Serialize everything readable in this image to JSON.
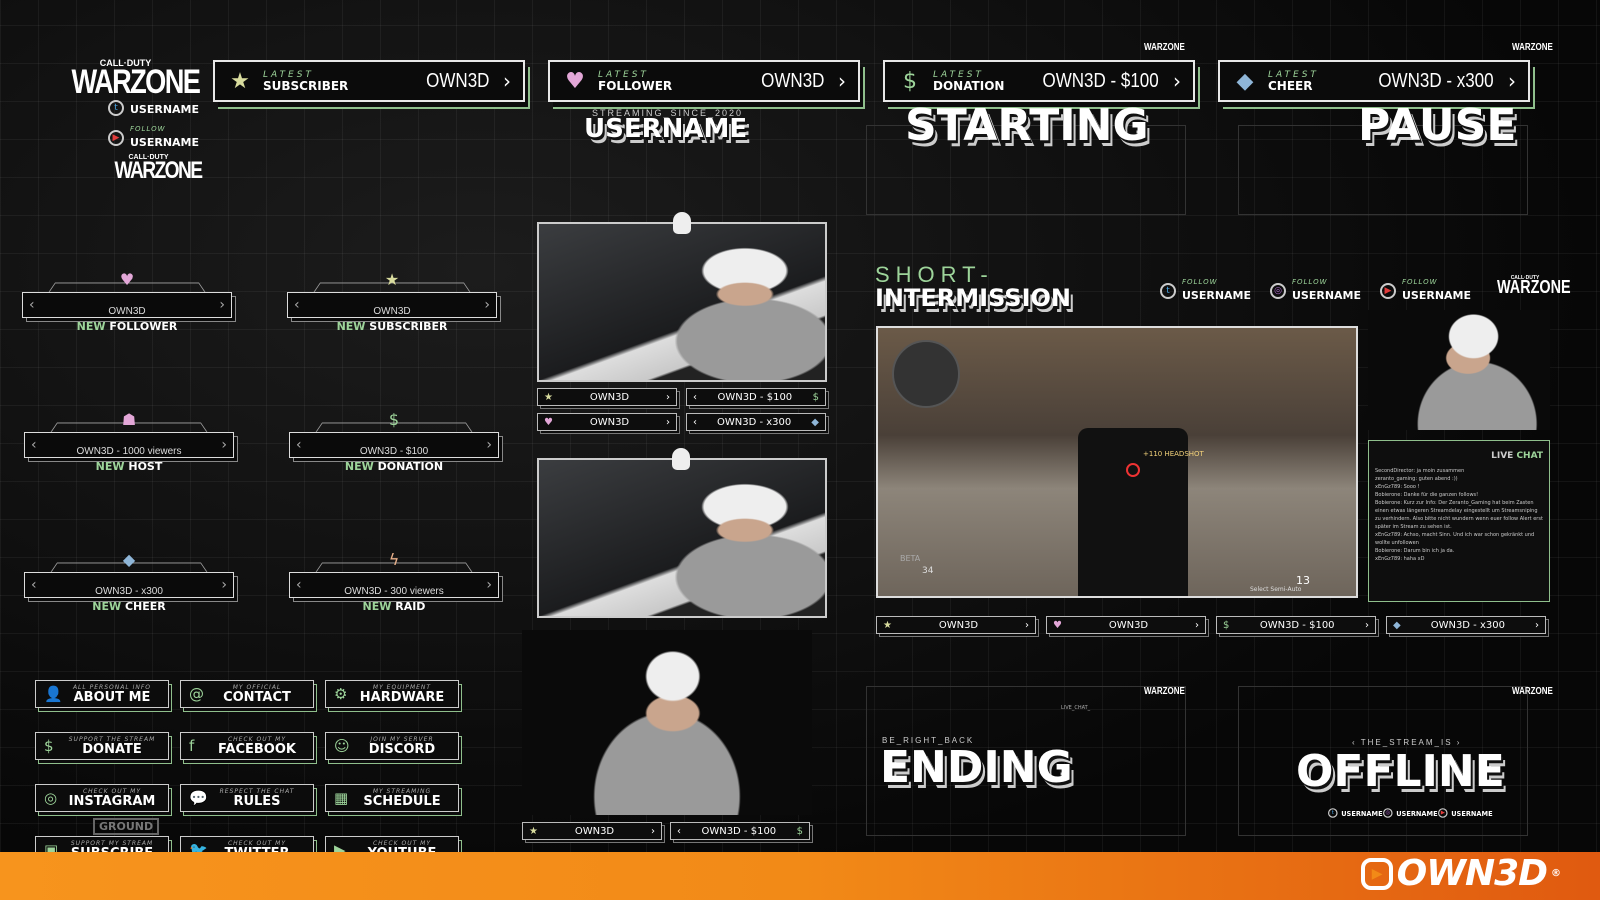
{
  "brand": {
    "game_logo_top": "CALL·DUTY",
    "game_logo_main": "WARZONE",
    "owned_logo": "OWN3D",
    "registered": "®"
  },
  "latest_bars": [
    {
      "label_small": "LATEST",
      "label": "SUBSCRIBER",
      "value": "OWN3D",
      "icon": "star-icon",
      "icon_glyph": "★",
      "color": "#d9dc9e"
    },
    {
      "label_small": "LATEST",
      "label": "FOLLOWER",
      "value": "OWN3D",
      "icon": "heart-icon",
      "icon_glyph": "♥",
      "color": "#e3a7d8"
    },
    {
      "label_small": "LATEST",
      "label": "DONATION",
      "value": "OWN3D - $100",
      "icon": "dollar-icon",
      "icon_glyph": "$",
      "color": "#9dd49a"
    },
    {
      "label_small": "LATEST",
      "label": "CHEER",
      "value": "OWN3D - x300",
      "icon": "diamond-icon",
      "icon_glyph": "◆",
      "color": "#8fb6d8"
    }
  ],
  "top_left": {
    "follow_1": {
      "label": "FOLLOW",
      "user": "USERNAME"
    },
    "follow_2": {
      "label": "FOLLOW",
      "user": "USERNAME"
    }
  },
  "streaming_since": "STREAMING_SINCE_2020",
  "username_title": "USERNAME",
  "scenes": {
    "starting": "STARTING",
    "pause": "PAUSE",
    "ending": "ENDING",
    "offline": "OFFLINE",
    "be_right_back": "BE_RIGHT_BACK",
    "the_stream_is": "‹ THE_STREAM_IS ›"
  },
  "intermission": {
    "line1": "SHORT-",
    "line2": "INTERMISSION",
    "follows": [
      {
        "label": "FOLLOW",
        "user": "USERNAME",
        "icon": "twitter-icon"
      },
      {
        "label": "FOLLOW",
        "user": "USERNAME",
        "icon": "instagram-icon"
      },
      {
        "label": "FOLLOW",
        "user": "USERNAME",
        "icon": "youtube-icon"
      }
    ]
  },
  "alerts": [
    {
      "prefix": "NEW",
      "type": "FOLLOWER",
      "value": "OWN3D",
      "icon": "heart-icon",
      "glyph": "♥",
      "color": "#e3a7d8"
    },
    {
      "prefix": "NEW",
      "type": "SUBSCRIBER",
      "value": "OWN3D",
      "icon": "star-icon",
      "glyph": "★",
      "color": "#d9dc9e"
    },
    {
      "prefix": "NEW",
      "type": "HOST",
      "value": "OWN3D - 1000 viewers",
      "icon": "group-icon",
      "glyph": "☗",
      "color": "#e3a7d8"
    },
    {
      "prefix": "NEW",
      "type": "DONATION",
      "value": "OWN3D - $100",
      "icon": "dollar-icon",
      "glyph": "$",
      "color": "#9dd49a"
    },
    {
      "prefix": "NEW",
      "type": "CHEER",
      "value": "OWN3D - x300",
      "icon": "diamond-icon",
      "glyph": "◆",
      "color": "#8fb6d8"
    },
    {
      "prefix": "NEW",
      "type": "RAID",
      "value": "OWN3D - 300 viewers",
      "icon": "lightning-icon",
      "glyph": "ϟ",
      "color": "#e8b08a"
    }
  ],
  "panels": [
    {
      "sub": "ALL PERSONAL INFO",
      "title": "ABOUT ME",
      "icon": "user-icon",
      "glyph": "👤"
    },
    {
      "sub": "MY OFFICIAL",
      "title": "CONTACT",
      "icon": "at-icon",
      "glyph": "@"
    },
    {
      "sub": "MY EQUIPMENT",
      "title": "HARDWARE",
      "icon": "gear-icon",
      "glyph": "⚙"
    },
    {
      "sub": "SUPPORT THE STREAM",
      "title": "DONATE",
      "icon": "dollar-icon",
      "glyph": "$"
    },
    {
      "sub": "CHECK OUT MY",
      "title": "FACEBOOK",
      "icon": "facebook-icon",
      "glyph": "f"
    },
    {
      "sub": "JOIN MY SERVER",
      "title": "DISCORD",
      "icon": "discord-icon",
      "glyph": "☺"
    },
    {
      "sub": "CHECK OUT MY",
      "title": "INSTAGRAM",
      "icon": "instagram-icon",
      "glyph": "◎"
    },
    {
      "sub": "RESPECT THE CHAT",
      "title": "RULES",
      "icon": "chat-icon",
      "glyph": "💬"
    },
    {
      "sub": "MY STREAMING",
      "title": "SCHEDULE",
      "icon": "calendar-icon",
      "glyph": "▦"
    },
    {
      "sub": "SUPPORT MY STREAM",
      "title": "SUBSCRIBE",
      "icon": "twitch-icon",
      "glyph": "▣"
    },
    {
      "sub": "CHECK OUT MY",
      "title": "TWITTER",
      "icon": "twitter-icon",
      "glyph": "🐦"
    },
    {
      "sub": "CHECK OUT MY",
      "title": "YOUTUBE",
      "icon": "youtube-icon",
      "glyph": "▶"
    }
  ],
  "ground_label": "GROUND",
  "cam_labels": {
    "sub": "OWN3D",
    "donation": "OWN3D - $100",
    "follower": "OWN3D",
    "cheer": "OWN3D - x300"
  },
  "chat": {
    "title_1": "LIVE",
    "title_2": "CHAT",
    "lines": [
      "SecondDirector: ja moin zusammen",
      "zeranto_gaming: guten abend :))",
      "xEnGz789: Sooo !",
      "Bobierone: Danke für die ganzen follows!",
      "Bobierone: Kurz zur Info: Der Zeranto_Gaming hat beim Zasten einen etwas längeren Streamdelay eingestellt um Streamsniping zu verhindern. Also bitte nicht wundern wenn euer follow Alert erst später im Stream zu sehen ist.",
      "xEnGz789: Achso, macht Sinn. Und ich war schon gekränkt und wollte unfollowen",
      "Bobierone: Darum bin ich ja da.",
      "xEnGz789: haha xD"
    ]
  },
  "game_hud": {
    "hit": "+110 HEADSHOT",
    "ammo": "13",
    "hint": "Select Semi-Auto",
    "beta": "BETA",
    "score": "34"
  },
  "small_labels": {
    "live_chat": "LIVE_CHAT_"
  }
}
